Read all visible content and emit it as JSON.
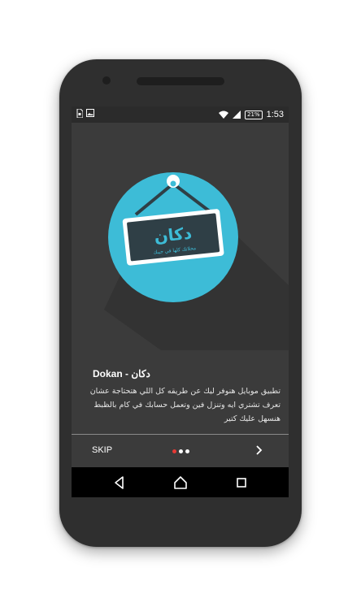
{
  "status_bar": {
    "left_icons": [
      "sim-card-icon",
      "image-icon"
    ],
    "right_icons": [
      "wifi-icon",
      "signal-icon"
    ],
    "battery": "21%",
    "time": "1:53"
  },
  "slide": {
    "sign_text": "دكان",
    "sign_subtext": "محلاتك كلها في جيبك",
    "title": "Dokan - دكان",
    "description": "تطبيق موبايل هنوفر ليك عن طريقه كل اللي هتحتاجة عشان تعرف تشتري ايه وتنزل فين وتعمل حسابك في كام بالظبط هنسهل عليك كتير"
  },
  "nav": {
    "skip_label": "SKIP",
    "page_indicator": {
      "current": 1,
      "total": 3
    },
    "colors": {
      "active_dot": "#e53935",
      "inactive_dot": "#ffffff"
    }
  },
  "system_nav": {
    "buttons": [
      "back-icon",
      "home-icon",
      "recents-icon"
    ]
  },
  "colors": {
    "screen_bg": "#3b3b3b",
    "circle": "#3dbcd7",
    "sign_bg": "#2f3f46",
    "accent_text": "#3dbcd7"
  }
}
